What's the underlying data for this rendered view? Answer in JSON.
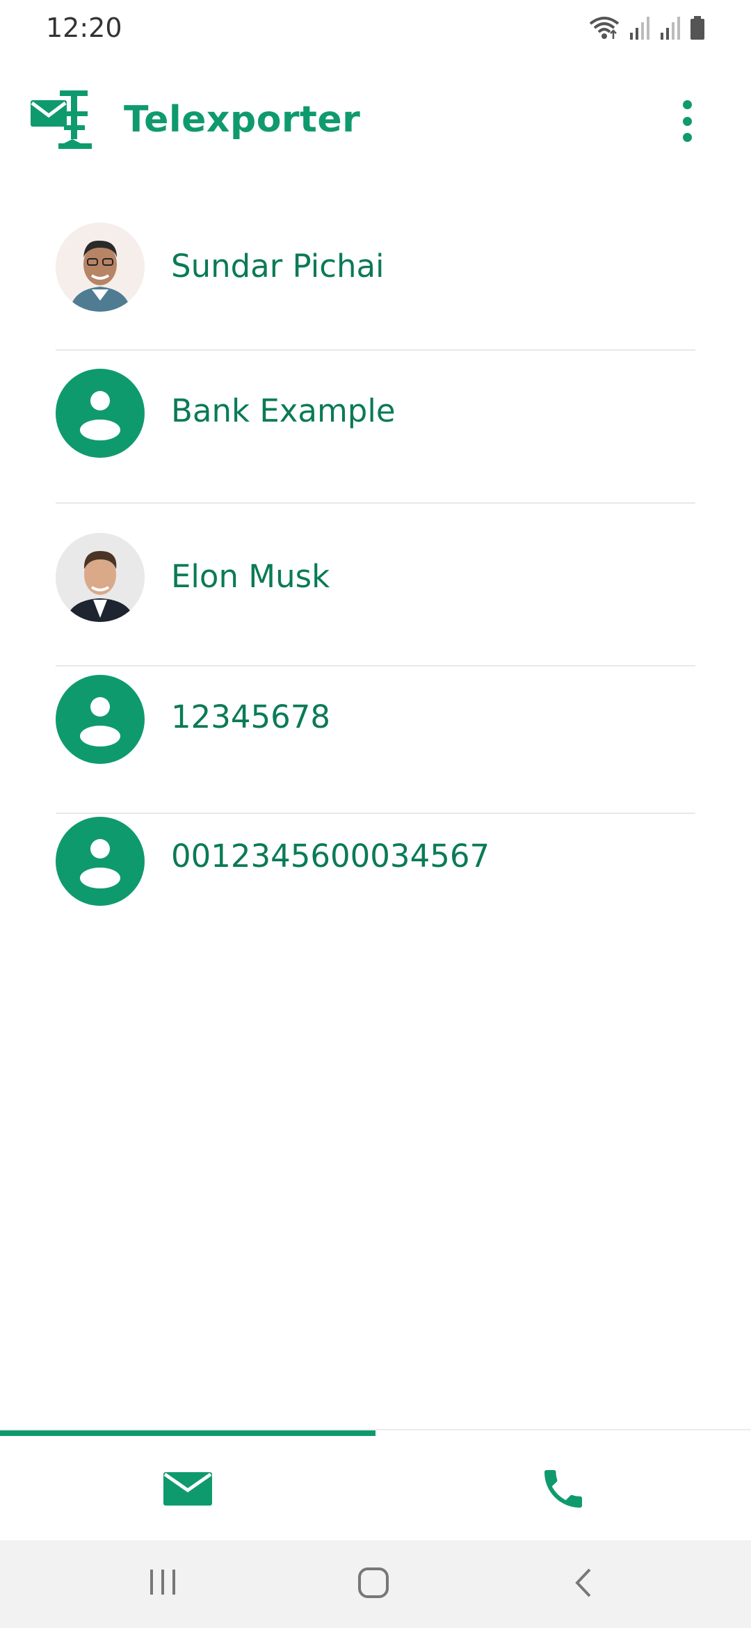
{
  "status_bar": {
    "time": "12:20",
    "icons": [
      "wifi-icon",
      "signal-icon",
      "signal-icon",
      "battery-icon"
    ]
  },
  "app_bar": {
    "title": "Telexporter",
    "logo_icon": "telexporter-logo-icon",
    "menu_icon": "more-vert-icon"
  },
  "contacts": [
    {
      "name": "Sundar Pichai",
      "avatar": "photo"
    },
    {
      "name": "Bank Example",
      "avatar": "generic-person-icon"
    },
    {
      "name": "Elon Musk",
      "avatar": "photo"
    },
    {
      "name": "12345678",
      "avatar": "generic-person-icon"
    },
    {
      "name": "0012345600034567",
      "avatar": "generic-person-icon"
    }
  ],
  "bottom_nav": {
    "tabs": [
      {
        "icon": "mail-icon",
        "selected": true
      },
      {
        "icon": "phone-icon",
        "selected": false
      }
    ]
  },
  "system_nav": {
    "buttons": [
      "recent-apps-icon",
      "home-icon",
      "back-icon"
    ]
  },
  "colors": {
    "accent": "#0f9a6e",
    "text_accent": "#0a7a57",
    "divider": "#e8e8e8",
    "nav_bg": "#f2f2f2"
  }
}
